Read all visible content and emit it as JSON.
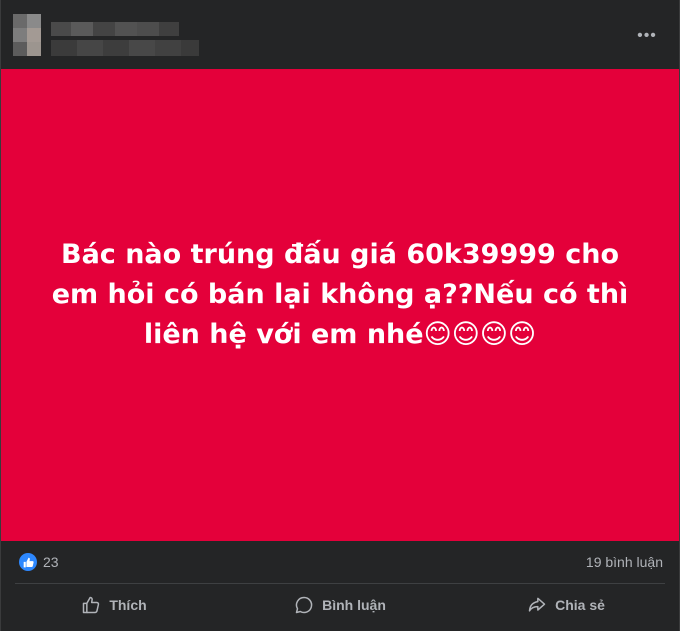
{
  "header": {
    "more_options_label": "•••"
  },
  "post": {
    "text": "Bác nào trúng đấu giá 60k39999 cho em hỏi có bán lại không ạ??Nếu có thì liên hệ với em nhé😊😊😊😊",
    "background_color": "#e4003a"
  },
  "stats": {
    "like_count": "23",
    "comment_count": "19 bình luận"
  },
  "actions": {
    "like_label": "Thích",
    "comment_label": "Bình luận",
    "share_label": "Chia sẻ"
  }
}
